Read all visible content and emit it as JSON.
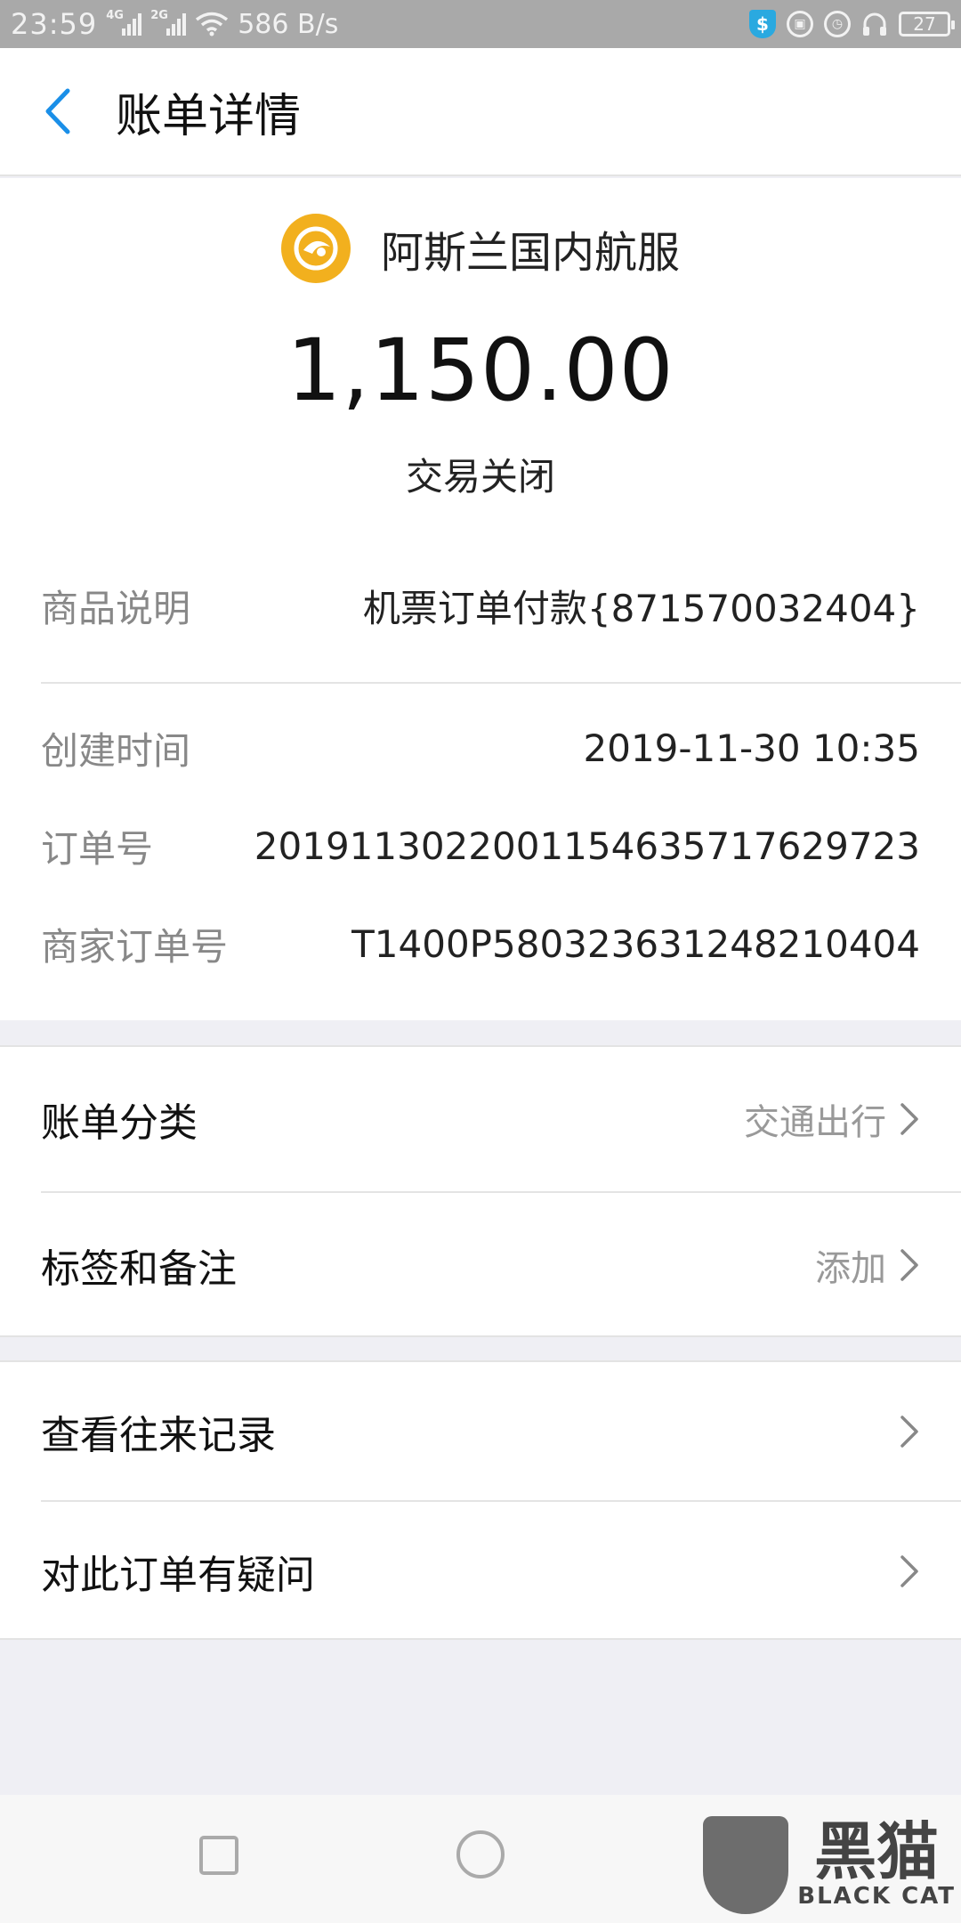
{
  "status_bar": {
    "time": "23:59",
    "net1": "4G",
    "net2": "2G",
    "speed": "586 B/s",
    "battery": "27"
  },
  "header": {
    "title": "账单详情"
  },
  "merchant": {
    "name": "阿斯兰国内航服",
    "logo_color": "#f2b01e"
  },
  "amount": "1,150.00",
  "status": "交易关闭",
  "details": {
    "product_label": "商品说明",
    "product_value": "机票订单付款{871570032404}",
    "created_label": "创建时间",
    "created_value": "2019-11-30 10:35",
    "order_label": "订单号",
    "order_value": "2019113022001154635717629723",
    "merchant_order_label": "商家订单号",
    "merchant_order_value": "T1400P580323631248210404"
  },
  "category": {
    "label": "账单分类",
    "value": "交通出行"
  },
  "tags": {
    "label": "标签和备注",
    "value": "添加"
  },
  "history": {
    "label": "查看往来记录"
  },
  "question": {
    "label": "对此订单有疑问"
  },
  "watermark": {
    "cn": "黑猫",
    "en": "BLACK CAT"
  },
  "colors": {
    "accent": "#1a8fe8",
    "status_bar": "#a9a9a9",
    "background": "#efeff4"
  }
}
